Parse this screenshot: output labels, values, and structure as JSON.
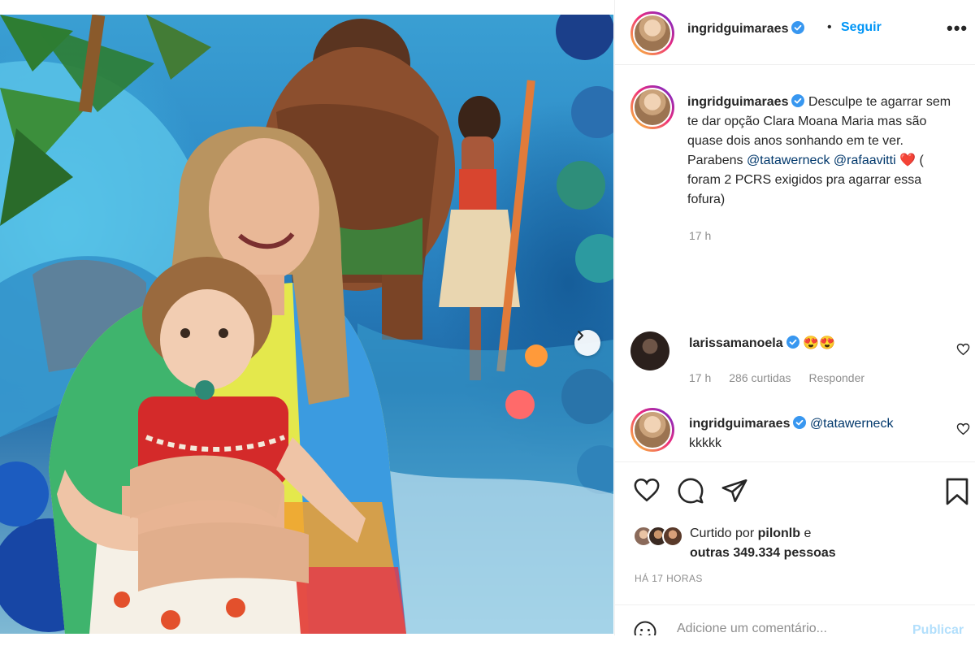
{
  "post": {
    "author": "ingridguimaraes",
    "follow_label": "Seguir",
    "separator": "•",
    "more_label": "•••",
    "caption_text_1": "Desculpe te agarrar sem te dar opção Clara Moana Maria mas são quase dois anos sonhando em te ver. Parabens ",
    "caption_mention_1": "@tatawerneck",
    "caption_mention_2": "@rafaavitti",
    "caption_heart": "❤️",
    "caption_text_2": " ( foram 2 PCRS exigidos pra agarrar essa fofura)",
    "caption_time": "17 h"
  },
  "comments": [
    {
      "username": "larissamanoela",
      "text": "😍😍",
      "time": "17 h",
      "likes": "286 curtidas",
      "reply": "Responder"
    },
    {
      "username": "ingridguimaraes",
      "mention": "@tatawerneck",
      "text": "kkkkk"
    }
  ],
  "engagement": {
    "liked_by_prefix": "Curtido por ",
    "liked_by_user": "pilonlb",
    "liked_by_suffix": " e",
    "others": "outras 349.334 pessoas",
    "posted_ago": "HÁ 17 HORAS"
  },
  "add_comment": {
    "placeholder": "Adicione um comentário...",
    "publish_label": "Publicar"
  },
  "colors": {
    "accent": "#0095f6",
    "mention": "#00376b",
    "muted": "#8e8e8e",
    "verified": "#3897f0",
    "like_red": "#ed4956"
  }
}
